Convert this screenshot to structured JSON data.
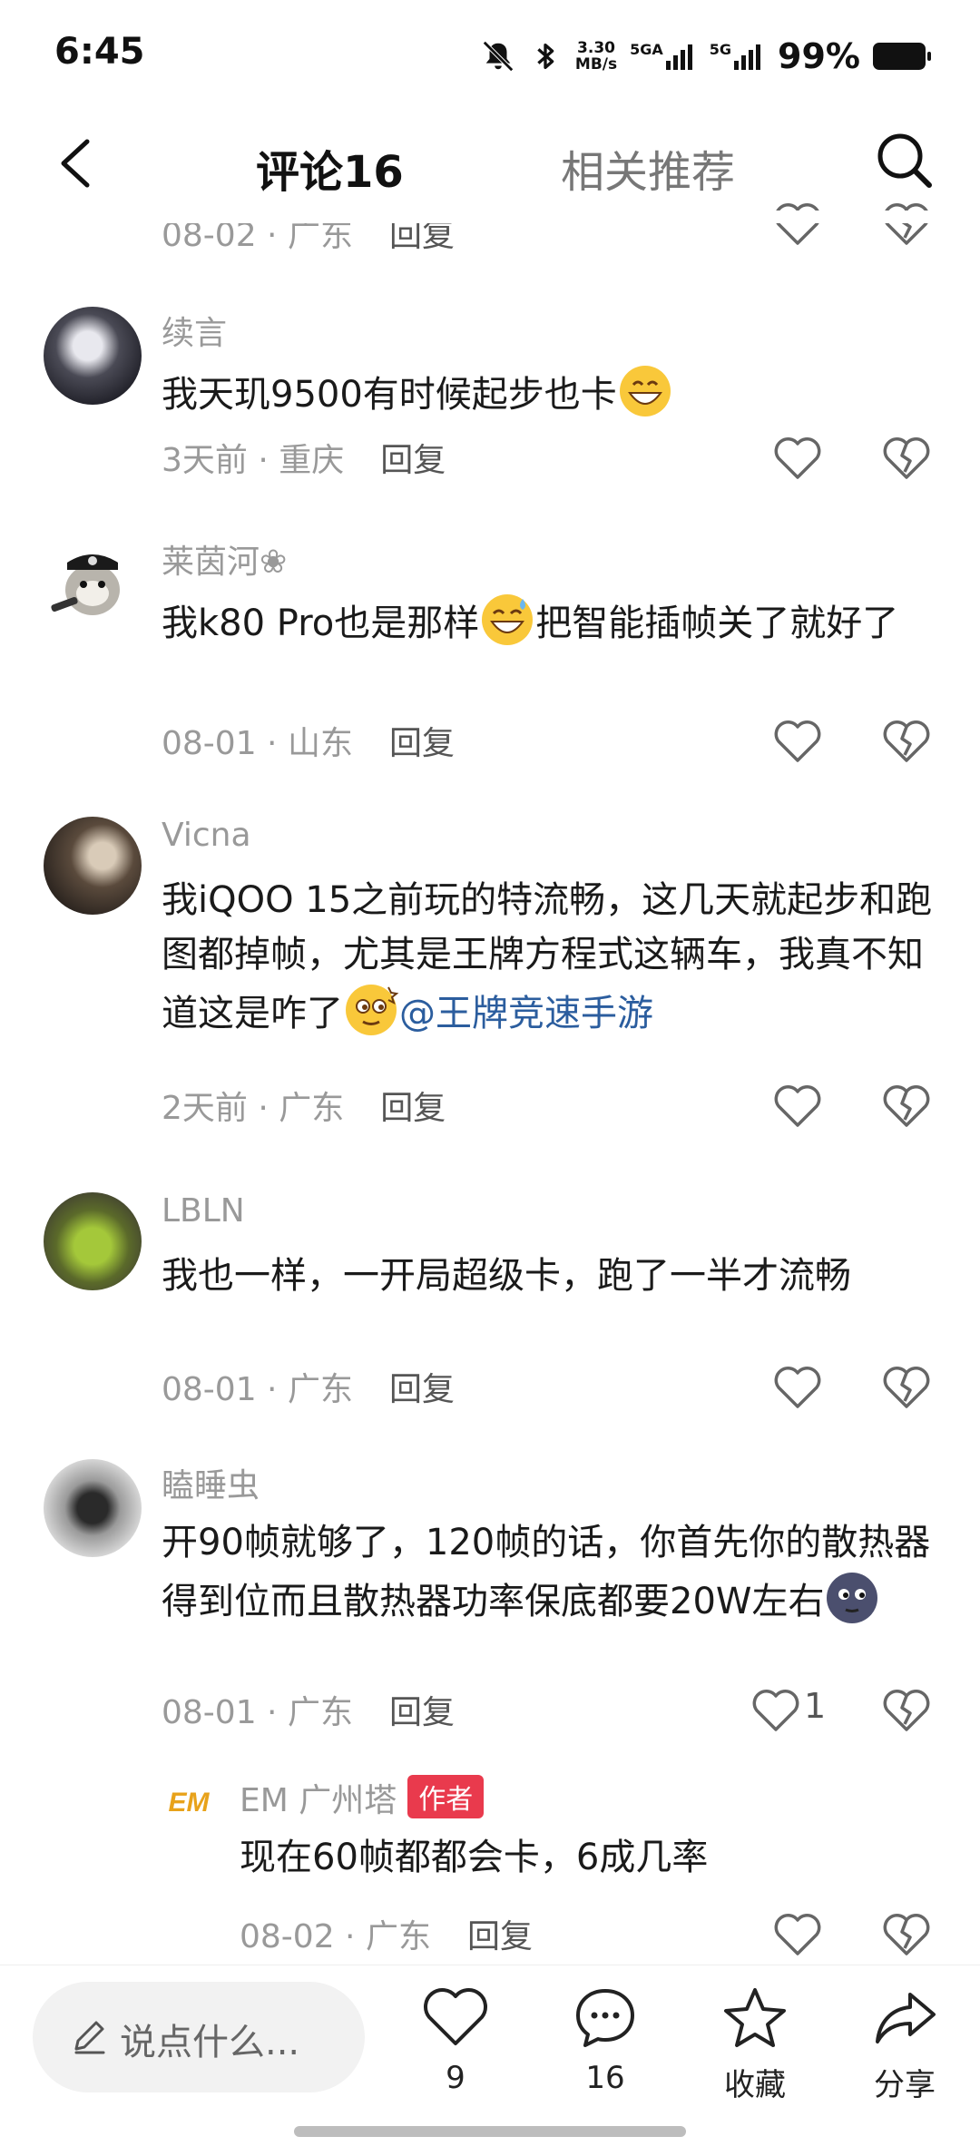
{
  "status_bar": {
    "time": "6:45",
    "net_speed_value": "3.30",
    "net_speed_unit": "MB/s",
    "sim1": "5GA",
    "sim2": "5G",
    "battery": "99%"
  },
  "header": {
    "tab_comments": "评论16",
    "tab_related": "相关推荐"
  },
  "top_partial": {
    "date": "08-02",
    "location": "广东",
    "reply": "回复"
  },
  "comments": [
    {
      "user": "续言",
      "text": "我天玑9500有时候起步也卡",
      "emoji": "grinning-emoji",
      "date": "3天前",
      "location": "重庆",
      "reply": "回复"
    },
    {
      "user": "莱茵河❀",
      "text_a": "我k80 Pro也是那样",
      "emoji": "sweat-smile-emoji",
      "text_b": "把智能插帧关了就好了",
      "date": "08-01",
      "location": "山东",
      "reply": "回复"
    },
    {
      "user": "Vicna",
      "text_a": "我iQOO 15之前玩的特流畅，这几天就起步和跑图都掉帧，尤其是王牌方程式这辆车，我真不知道这是咋了",
      "emoji": "dizzy-emoji",
      "mention": "@王牌竞速手游",
      "date": "2天前",
      "location": "广东",
      "reply": "回复"
    },
    {
      "user": "LBLN",
      "text": "我也一样，一开局超级卡，跑了一半才流畅",
      "date": "08-01",
      "location": "广东",
      "reply": "回复"
    },
    {
      "user": "瞌睡虫",
      "text": "开90帧就够了，120帧的话，你首先你的散热器得到位而且散热器功率保底都要20W左右",
      "emoji": "moon-face-emoji",
      "date": "08-01",
      "location": "广东",
      "reply": "回复",
      "likes": "1"
    }
  ],
  "reply_item": {
    "user": "EM 广州塔",
    "badge": "作者",
    "avatar_text": "EM",
    "text": "现在60帧都都会卡，6成几率",
    "date": "08-02",
    "location": "广东",
    "reply": "回复"
  },
  "bottom_bar": {
    "input_placeholder": "说点什么...",
    "likes": "9",
    "comments": "16",
    "favorite": "收藏",
    "share": "分享"
  },
  "colors": {
    "accent_text": "#1a1a1a",
    "meta_gray": "#999999",
    "mention_blue": "#2b5d9e",
    "author_badge": "#e93a4d"
  }
}
